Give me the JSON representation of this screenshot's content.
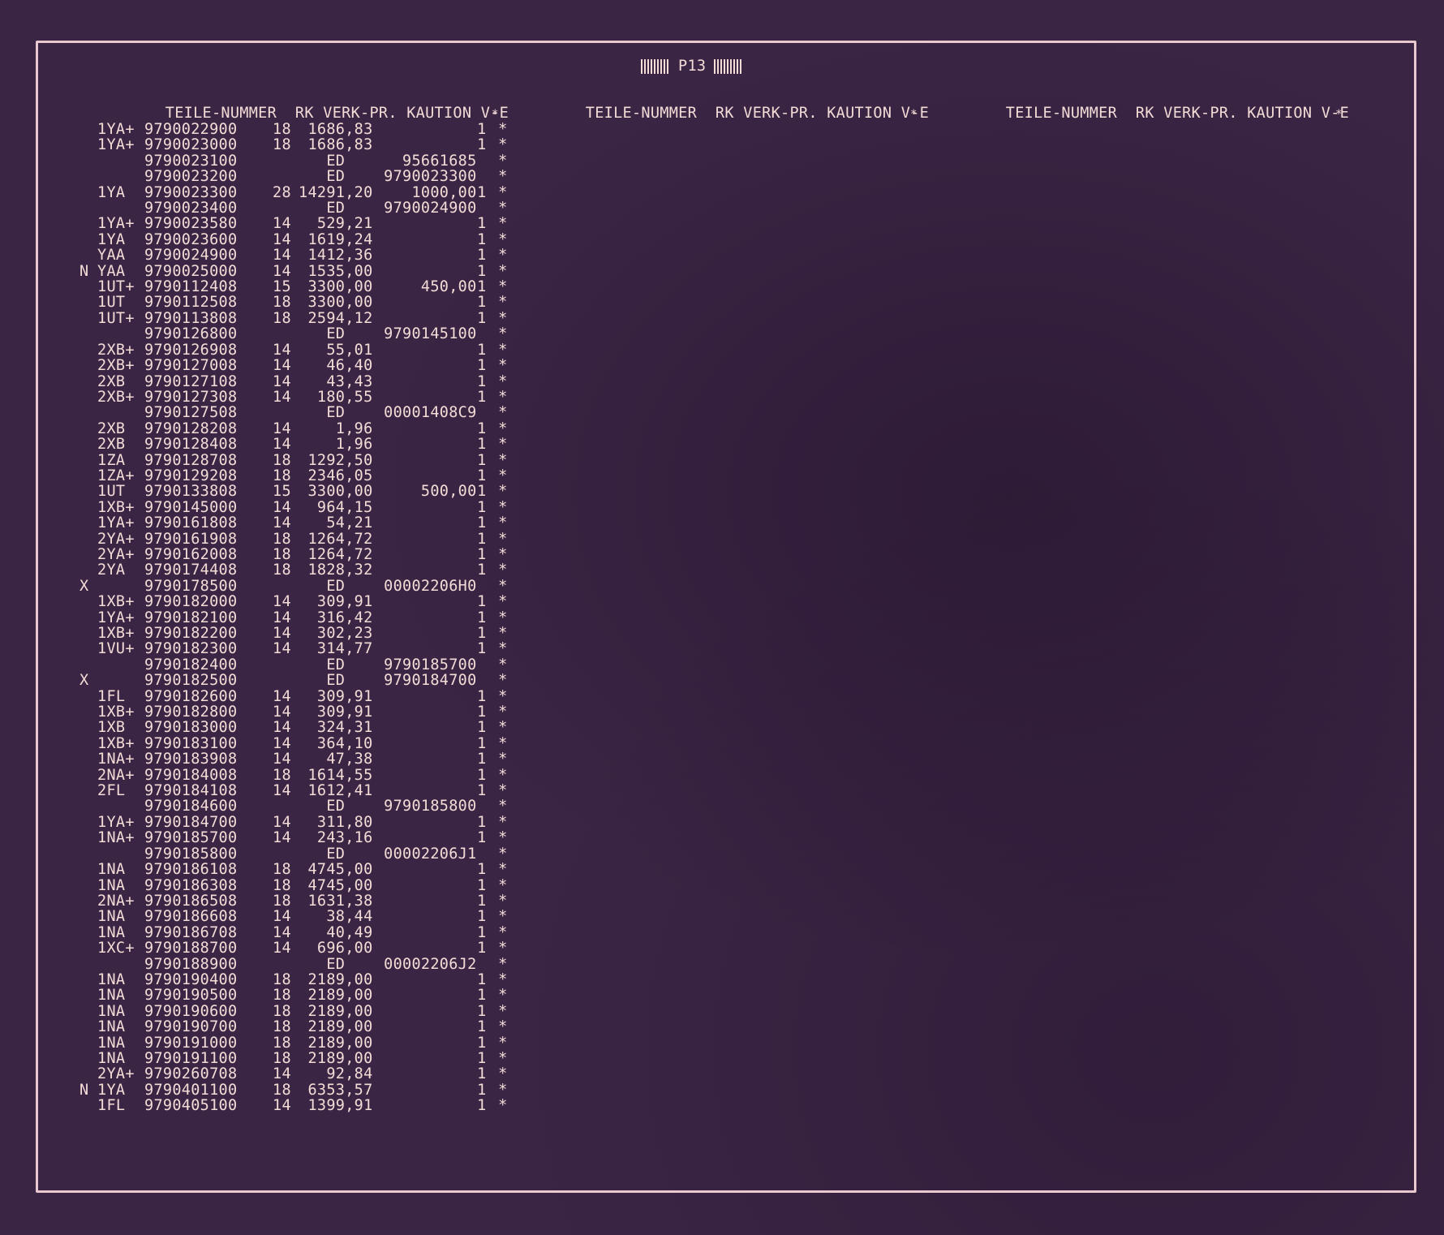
{
  "page": {
    "title": "P13",
    "trailing_star": "*",
    "headers": [
      {
        "teile": "TEILE-NUMMER",
        "rk": "RK",
        "verk": "VERK-PR.",
        "kaution": "KAUTION",
        "ve": "V-E"
      },
      {
        "teile": "TEILE-NUMMER",
        "rk": "RK",
        "verk": "VERK-PR.",
        "kaution": "KAUTION",
        "ve": "V-E"
      },
      {
        "teile": "TEILE-NUMMER",
        "rk": "RK",
        "verk": "VERK-PR.",
        "kaution": "KAUTION",
        "ve": "V-E"
      }
    ]
  },
  "rows": [
    {
      "flag": "",
      "code": "1YA+",
      "num": "9790022900",
      "rk": "18",
      "price": "1686,83",
      "kaution": "",
      "ve": "1",
      "star": "*"
    },
    {
      "flag": "",
      "code": "1YA+",
      "num": "9790023000",
      "rk": "18",
      "price": "1686,83",
      "kaution": "",
      "ve": "1",
      "star": "*"
    },
    {
      "flag": "",
      "code": "",
      "num": "9790023100",
      "rk": "",
      "price": "ED",
      "kaution": "95661685",
      "ve": "",
      "star": "*"
    },
    {
      "flag": "",
      "code": "",
      "num": "9790023200",
      "rk": "",
      "price": "ED",
      "kaution": "9790023300",
      "ve": "",
      "star": "*"
    },
    {
      "flag": "",
      "code": "1YA",
      "num": "9790023300",
      "rk": "28",
      "price": "14291,20",
      "kaution": "1000,00",
      "ve": "1",
      "star": "*"
    },
    {
      "flag": "",
      "code": "",
      "num": "9790023400",
      "rk": "",
      "price": "ED",
      "kaution": "9790024900",
      "ve": "",
      "star": "*"
    },
    {
      "flag": "",
      "code": "1YA+",
      "num": "9790023580",
      "rk": "14",
      "price": "529,21",
      "kaution": "",
      "ve": "1",
      "star": "*"
    },
    {
      "flag": "",
      "code": "1YA",
      "num": "9790023600",
      "rk": "14",
      "price": "1619,24",
      "kaution": "",
      "ve": "1",
      "star": "*"
    },
    {
      "flag": "",
      "code": "YAA",
      "num": "9790024900",
      "rk": "14",
      "price": "1412,36",
      "kaution": "",
      "ve": "1",
      "star": "*"
    },
    {
      "flag": "N",
      "code": "YAA",
      "num": "9790025000",
      "rk": "14",
      "price": "1535,00",
      "kaution": "",
      "ve": "1",
      "star": "*"
    },
    {
      "flag": "",
      "code": "1UT+",
      "num": "9790112408",
      "rk": "15",
      "price": "3300,00",
      "kaution": "450,00",
      "ve": "1",
      "star": "*"
    },
    {
      "flag": "",
      "code": "1UT",
      "num": "9790112508",
      "rk": "18",
      "price": "3300,00",
      "kaution": "",
      "ve": "1",
      "star": "*"
    },
    {
      "flag": "",
      "code": "1UT+",
      "num": "9790113808",
      "rk": "18",
      "price": "2594,12",
      "kaution": "",
      "ve": "1",
      "star": "*"
    },
    {
      "flag": "",
      "code": "",
      "num": "9790126800",
      "rk": "",
      "price": "ED",
      "kaution": "9790145100",
      "ve": "",
      "star": "*"
    },
    {
      "flag": "",
      "code": "2XB+",
      "num": "9790126908",
      "rk": "14",
      "price": "55,01",
      "kaution": "",
      "ve": "1",
      "star": "*"
    },
    {
      "flag": "",
      "code": "2XB+",
      "num": "9790127008",
      "rk": "14",
      "price": "46,40",
      "kaution": "",
      "ve": "1",
      "star": "*"
    },
    {
      "flag": "",
      "code": "2XB",
      "num": "9790127108",
      "rk": "14",
      "price": "43,43",
      "kaution": "",
      "ve": "1",
      "star": "*"
    },
    {
      "flag": "",
      "code": "2XB+",
      "num": "9790127308",
      "rk": "14",
      "price": "180,55",
      "kaution": "",
      "ve": "1",
      "star": "*"
    },
    {
      "flag": "",
      "code": "",
      "num": "9790127508",
      "rk": "",
      "price": "ED",
      "kaution": "00001408C9",
      "ve": "",
      "star": "*"
    },
    {
      "flag": "",
      "code": "2XB",
      "num": "9790128208",
      "rk": "14",
      "price": "1,96",
      "kaution": "",
      "ve": "1",
      "star": "*"
    },
    {
      "flag": "",
      "code": "2XB",
      "num": "9790128408",
      "rk": "14",
      "price": "1,96",
      "kaution": "",
      "ve": "1",
      "star": "*"
    },
    {
      "flag": "",
      "code": "1ZA",
      "num": "9790128708",
      "rk": "18",
      "price": "1292,50",
      "kaution": "",
      "ve": "1",
      "star": "*"
    },
    {
      "flag": "",
      "code": "1ZA+",
      "num": "9790129208",
      "rk": "18",
      "price": "2346,05",
      "kaution": "",
      "ve": "1",
      "star": "*"
    },
    {
      "flag": "",
      "code": "1UT",
      "num": "9790133808",
      "rk": "15",
      "price": "3300,00",
      "kaution": "500,00",
      "ve": "1",
      "star": "*"
    },
    {
      "flag": "",
      "code": "1XB+",
      "num": "9790145000",
      "rk": "14",
      "price": "964,15",
      "kaution": "",
      "ve": "1",
      "star": "*"
    },
    {
      "flag": "",
      "code": "1YA+",
      "num": "9790161808",
      "rk": "14",
      "price": "54,21",
      "kaution": "",
      "ve": "1",
      "star": "*"
    },
    {
      "flag": "",
      "code": "2YA+",
      "num": "9790161908",
      "rk": "18",
      "price": "1264,72",
      "kaution": "",
      "ve": "1",
      "star": "*"
    },
    {
      "flag": "",
      "code": "2YA+",
      "num": "9790162008",
      "rk": "18",
      "price": "1264,72",
      "kaution": "",
      "ve": "1",
      "star": "*"
    },
    {
      "flag": "",
      "code": "2YA",
      "num": "9790174408",
      "rk": "18",
      "price": "1828,32",
      "kaution": "",
      "ve": "1",
      "star": "*"
    },
    {
      "flag": "X",
      "code": "",
      "num": "9790178500",
      "rk": "",
      "price": "ED",
      "kaution": "00002206H0",
      "ve": "",
      "star": "*"
    },
    {
      "flag": "",
      "code": "1XB+",
      "num": "9790182000",
      "rk": "14",
      "price": "309,91",
      "kaution": "",
      "ve": "1",
      "star": "*"
    },
    {
      "flag": "",
      "code": "1YA+",
      "num": "9790182100",
      "rk": "14",
      "price": "316,42",
      "kaution": "",
      "ve": "1",
      "star": "*"
    },
    {
      "flag": "",
      "code": "1XB+",
      "num": "9790182200",
      "rk": "14",
      "price": "302,23",
      "kaution": "",
      "ve": "1",
      "star": "*"
    },
    {
      "flag": "",
      "code": "1VU+",
      "num": "9790182300",
      "rk": "14",
      "price": "314,77",
      "kaution": "",
      "ve": "1",
      "star": "*"
    },
    {
      "flag": "",
      "code": "",
      "num": "9790182400",
      "rk": "",
      "price": "ED",
      "kaution": "9790185700",
      "ve": "",
      "star": "*"
    },
    {
      "flag": "X",
      "code": "",
      "num": "9790182500",
      "rk": "",
      "price": "ED",
      "kaution": "9790184700",
      "ve": "",
      "star": "*"
    },
    {
      "flag": "",
      "code": "1FL",
      "num": "9790182600",
      "rk": "14",
      "price": "309,91",
      "kaution": "",
      "ve": "1",
      "star": "*"
    },
    {
      "flag": "",
      "code": "1XB+",
      "num": "9790182800",
      "rk": "14",
      "price": "309,91",
      "kaution": "",
      "ve": "1",
      "star": "*"
    },
    {
      "flag": "",
      "code": "1XB",
      "num": "9790183000",
      "rk": "14",
      "price": "324,31",
      "kaution": "",
      "ve": "1",
      "star": "*"
    },
    {
      "flag": "",
      "code": "1XB+",
      "num": "9790183100",
      "rk": "14",
      "price": "364,10",
      "kaution": "",
      "ve": "1",
      "star": "*"
    },
    {
      "flag": "",
      "code": "1NA+",
      "num": "9790183908",
      "rk": "14",
      "price": "47,38",
      "kaution": "",
      "ve": "1",
      "star": "*"
    },
    {
      "flag": "",
      "code": "2NA+",
      "num": "9790184008",
      "rk": "18",
      "price": "1614,55",
      "kaution": "",
      "ve": "1",
      "star": "*"
    },
    {
      "flag": "",
      "code": "2FL",
      "num": "9790184108",
      "rk": "14",
      "price": "1612,41",
      "kaution": "",
      "ve": "1",
      "star": "*"
    },
    {
      "flag": "",
      "code": "",
      "num": "9790184600",
      "rk": "",
      "price": "ED",
      "kaution": "9790185800",
      "ve": "",
      "star": "*"
    },
    {
      "flag": "",
      "code": "1YA+",
      "num": "9790184700",
      "rk": "14",
      "price": "311,80",
      "kaution": "",
      "ve": "1",
      "star": "*"
    },
    {
      "flag": "",
      "code": "1NA+",
      "num": "9790185700",
      "rk": "14",
      "price": "243,16",
      "kaution": "",
      "ve": "1",
      "star": "*"
    },
    {
      "flag": "",
      "code": "",
      "num": "9790185800",
      "rk": "",
      "price": "ED",
      "kaution": "00002206J1",
      "ve": "",
      "star": "*"
    },
    {
      "flag": "",
      "code": "1NA",
      "num": "9790186108",
      "rk": "18",
      "price": "4745,00",
      "kaution": "",
      "ve": "1",
      "star": "*"
    },
    {
      "flag": "",
      "code": "1NA",
      "num": "9790186308",
      "rk": "18",
      "price": "4745,00",
      "kaution": "",
      "ve": "1",
      "star": "*"
    },
    {
      "flag": "",
      "code": "2NA+",
      "num": "9790186508",
      "rk": "18",
      "price": "1631,38",
      "kaution": "",
      "ve": "1",
      "star": "*"
    },
    {
      "flag": "",
      "code": "1NA",
      "num": "9790186608",
      "rk": "14",
      "price": "38,44",
      "kaution": "",
      "ve": "1",
      "star": "*"
    },
    {
      "flag": "",
      "code": "1NA",
      "num": "9790186708",
      "rk": "14",
      "price": "40,49",
      "kaution": "",
      "ve": "1",
      "star": "*"
    },
    {
      "flag": "",
      "code": "1XC+",
      "num": "9790188700",
      "rk": "14",
      "price": "696,00",
      "kaution": "",
      "ve": "1",
      "star": "*"
    },
    {
      "flag": "",
      "code": "",
      "num": "9790188900",
      "rk": "",
      "price": "ED",
      "kaution": "00002206J2",
      "ve": "",
      "star": "*"
    },
    {
      "flag": "",
      "code": "1NA",
      "num": "9790190400",
      "rk": "18",
      "price": "2189,00",
      "kaution": "",
      "ve": "1",
      "star": "*"
    },
    {
      "flag": "",
      "code": "1NA",
      "num": "9790190500",
      "rk": "18",
      "price": "2189,00",
      "kaution": "",
      "ve": "1",
      "star": "*"
    },
    {
      "flag": "",
      "code": "1NA",
      "num": "9790190600",
      "rk": "18",
      "price": "2189,00",
      "kaution": "",
      "ve": "1",
      "star": "*"
    },
    {
      "flag": "",
      "code": "1NA",
      "num": "9790190700",
      "rk": "18",
      "price": "2189,00",
      "kaution": "",
      "ve": "1",
      "star": "*"
    },
    {
      "flag": "",
      "code": "1NA",
      "num": "9790191000",
      "rk": "18",
      "price": "2189,00",
      "kaution": "",
      "ve": "1",
      "star": "*"
    },
    {
      "flag": "",
      "code": "1NA",
      "num": "9790191100",
      "rk": "18",
      "price": "2189,00",
      "kaution": "",
      "ve": "1",
      "star": "*"
    },
    {
      "flag": "",
      "code": "2YA+",
      "num": "9790260708",
      "rk": "14",
      "price": "92,84",
      "kaution": "",
      "ve": "1",
      "star": "*"
    },
    {
      "flag": "N",
      "code": "1YA",
      "num": "9790401100",
      "rk": "18",
      "price": "6353,57",
      "kaution": "",
      "ve": "1",
      "star": "*"
    },
    {
      "flag": "",
      "code": "1FL",
      "num": "9790405100",
      "rk": "14",
      "price": "1399,91",
      "kaution": "",
      "ve": "1",
      "star": "*"
    }
  ]
}
